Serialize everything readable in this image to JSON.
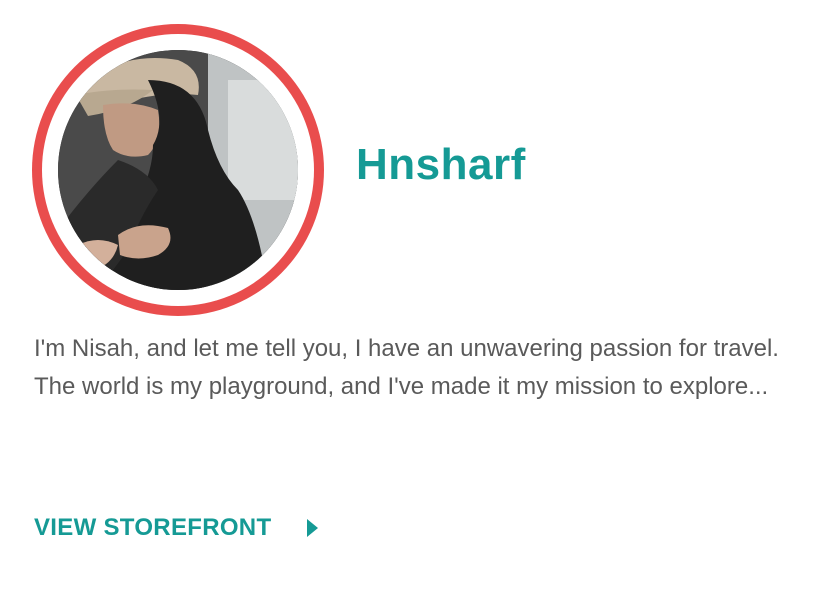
{
  "profile": {
    "name": "Hnsharf",
    "bio": "I'm Nisah, and let me tell you, I have an unwavering passion for travel. The world is my playground, and I've made it my mission to explore...",
    "cta_label": "VIEW STOREFRONT",
    "cta_icon": "play-triangle-icon"
  },
  "colors": {
    "accent": "#159a95",
    "ring": "#e94d4d",
    "body_text": "#5a5a5a"
  }
}
